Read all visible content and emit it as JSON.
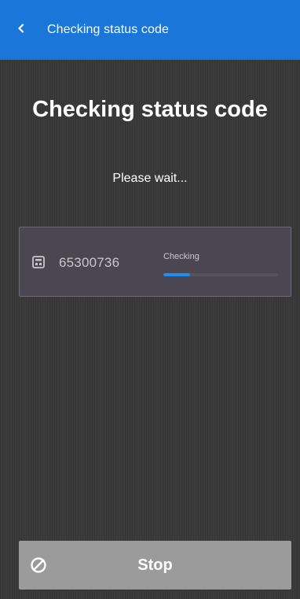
{
  "appbar": {
    "title": "Checking status code",
    "back_icon": "chevron-left-icon",
    "color": "#1a76d8"
  },
  "main": {
    "heading": "Checking status code",
    "subtitle": "Please wait..."
  },
  "items": [
    {
      "icon": "calculator-icon",
      "code": "65300736",
      "status": "Checking",
      "progress_fraction": 0.23
    }
  ],
  "footer": {
    "stop_label": "Stop",
    "stop_icon": "cancel-circle-icon"
  },
  "colors": {
    "accent": "#1c8ff0",
    "background": "#3b3b3b",
    "card": "#4a4753",
    "button": "#9b9b9b"
  }
}
